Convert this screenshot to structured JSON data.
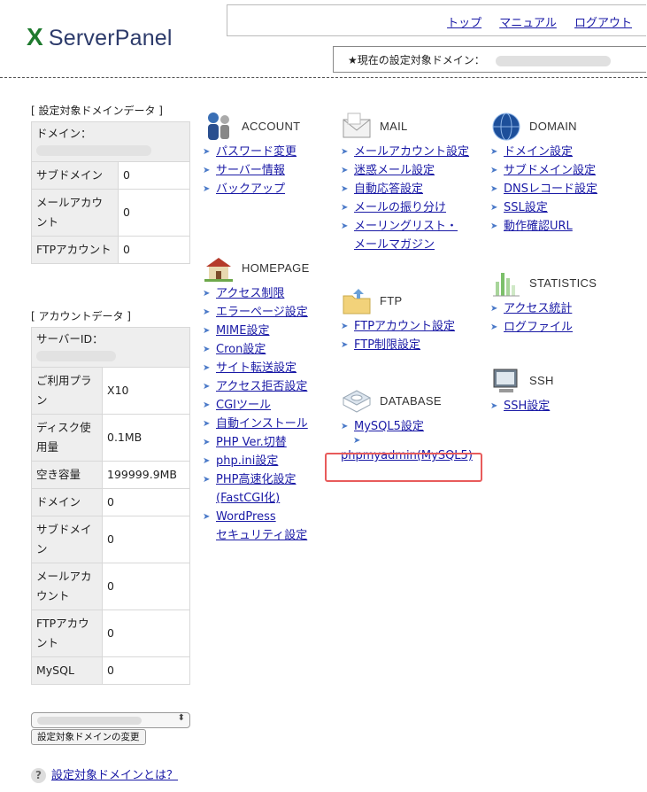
{
  "header": {
    "logo_x": "X",
    "logo_text": "ServerPanel",
    "nav": [
      "トップ",
      "マニュアル",
      "ログアウト"
    ],
    "current_domain_label": "★現在の設定対象ドメイン："
  },
  "domain_data": {
    "caption": "[ 設定対象ドメインデータ ]",
    "domain_label": "ドメイン：",
    "rows": [
      {
        "key": "サブドメイン",
        "value": "0"
      },
      {
        "key": "メールアカウント",
        "value": "0"
      },
      {
        "key": "FTPアカウント",
        "value": "0"
      }
    ]
  },
  "account_data": {
    "caption": "[ アカウントデータ ]",
    "server_id_label": "サーバーID：",
    "rows": [
      {
        "key": "ご利用プラン",
        "value": "X10"
      },
      {
        "key": "ディスク使用量",
        "value": "0.1MB"
      },
      {
        "key": "空き容量",
        "value": "199999.9MB"
      },
      {
        "key": "ドメイン",
        "value": "0"
      },
      {
        "key": "サブドメイン",
        "value": "0"
      },
      {
        "key": "メールアカウント",
        "value": "0"
      },
      {
        "key": "FTPアカウント",
        "value": "0"
      },
      {
        "key": "MySQL",
        "value": "0"
      }
    ]
  },
  "change_button": "設定対象ドメインの変更",
  "help_link": "設定対象ドメインとは？",
  "sections": {
    "account": {
      "title": "ACCOUNT",
      "links": [
        "パスワード変更",
        "サーバー情報",
        "バックアップ"
      ]
    },
    "homepage": {
      "title": "HOMEPAGE",
      "links": [
        "アクセス制限",
        "エラーページ設定",
        "MIME設定",
        "Cron設定",
        "サイト転送設定",
        "アクセス拒否設定",
        "CGIツール",
        "自動インストール",
        "PHP Ver.切替",
        "php.ini設定",
        "PHP高速化設定",
        "(FastCGI化)",
        "WordPress",
        "セキュリティ設定"
      ]
    },
    "mail": {
      "title": "MAIL",
      "links": [
        "メールアカウント設定",
        "迷惑メール設定",
        "自動応答設定",
        "メールの振り分け",
        "メーリングリスト・",
        "メールマガジン"
      ]
    },
    "ftp": {
      "title": "FTP",
      "links": [
        "FTPアカウント設定",
        "FTP制限設定"
      ]
    },
    "database": {
      "title": "DATABASE",
      "links": [
        "MySQL5設定",
        "phpmyadmin(MySQL5)"
      ]
    },
    "domain": {
      "title": "DOMAIN",
      "links": [
        "ドメイン設定",
        "サブドメイン設定",
        "DNSレコード設定",
        "SSL設定",
        "動作確認URL"
      ]
    },
    "statistics": {
      "title": "STATISTICS",
      "links": [
        "アクセス統計",
        "ログファイル"
      ]
    },
    "ssh": {
      "title": "SSH",
      "links": [
        "SSH設定"
      ]
    }
  },
  "colors": {
    "link": "#1a1aa6",
    "highlight": "#e85b5b",
    "logo_x": "#1e7a2e"
  }
}
